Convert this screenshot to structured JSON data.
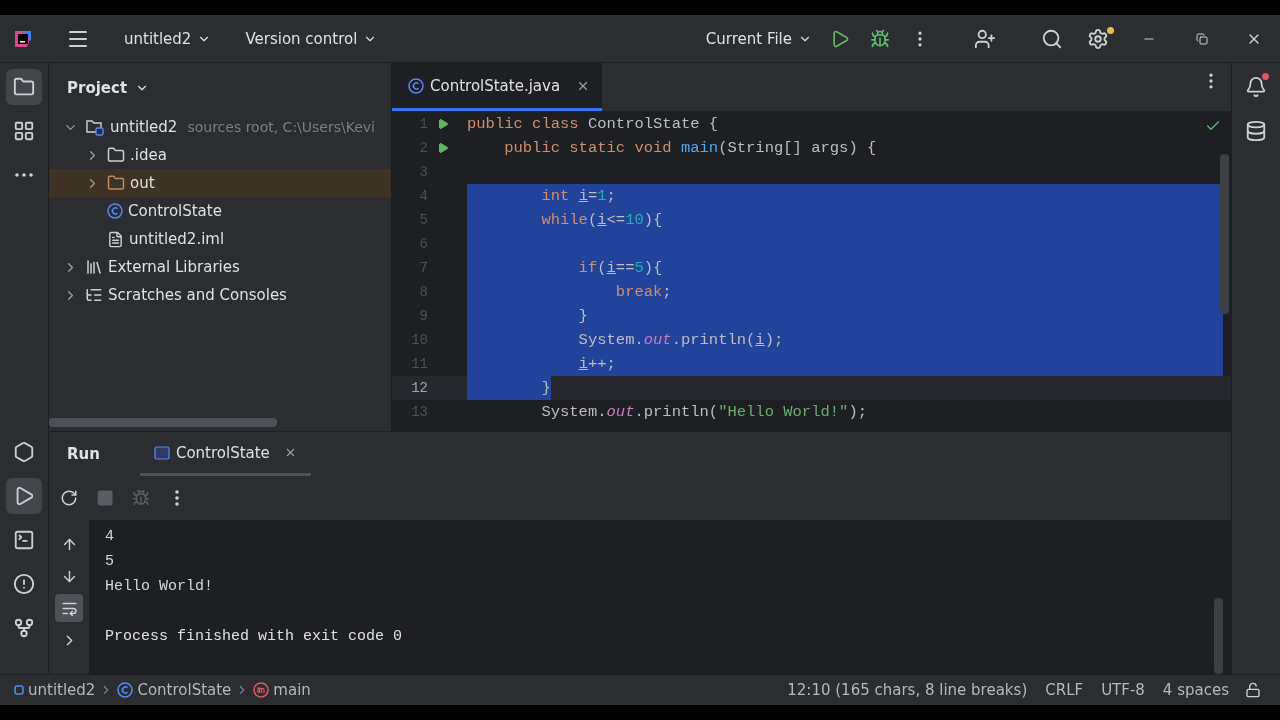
{
  "title_bar": {
    "project": "untitled2",
    "vcs": "Version control",
    "run_config": "Current File",
    "settings_badge": true
  },
  "left_stripe": {
    "top": [
      {
        "kind": "project",
        "selected": true
      },
      {
        "kind": "structure",
        "selected": false
      },
      {
        "kind": "more",
        "selected": false
      }
    ],
    "bottom": [
      {
        "kind": "services",
        "selected": false
      },
      {
        "kind": "run",
        "selected": true
      },
      {
        "kind": "terminal",
        "selected": false
      },
      {
        "kind": "problems",
        "selected": false
      },
      {
        "kind": "git",
        "selected": false
      }
    ]
  },
  "project_panel": {
    "title": "Project",
    "tree": [
      {
        "label": "untitled2",
        "kind": "module",
        "hint": "sources root,  C:\\Users\\Kevi",
        "expanded": true,
        "children": [
          {
            "label": ".idea",
            "kind": "folder",
            "expanded": false
          },
          {
            "label": "out",
            "kind": "excluded_folder",
            "expanded": false
          },
          {
            "label": "ControlState",
            "kind": "class"
          },
          {
            "label": "untitled2.iml",
            "kind": "file"
          }
        ]
      },
      {
        "label": "External Libraries",
        "kind": "libraries",
        "expanded": false
      },
      {
        "label": "Scratches and Consoles",
        "kind": "scratches",
        "expanded": false
      }
    ]
  },
  "editor": {
    "tabs": [
      {
        "label": "ControlState.java",
        "selected": true
      }
    ],
    "inspection_ok": true,
    "lines": [
      {
        "number": "1",
        "run_marker": true,
        "selected": false,
        "current": false,
        "tokens": [
          {
            "text": "public class ",
            "kind": "keyword"
          },
          {
            "text": "ControlState {",
            "kind": "plain"
          }
        ]
      },
      {
        "number": "2",
        "run_marker": true,
        "selected": false,
        "current": false,
        "tokens": [
          {
            "text": "    public static void ",
            "kind": "keyword"
          },
          {
            "text": "main",
            "kind": "method"
          },
          {
            "text": "(String[] args) {",
            "kind": "plain"
          }
        ]
      },
      {
        "number": "3",
        "run_marker": false,
        "selected": false,
        "current": false
      },
      {
        "number": "4",
        "run_marker": false,
        "selected": true,
        "current": false,
        "tokens": [
          {
            "text": "        int ",
            "kind": "keyword"
          },
          {
            "text": "i",
            "kind": "var"
          },
          {
            "text": "=",
            "kind": "plain"
          },
          {
            "text": "1",
            "kind": "number"
          },
          {
            "text": ";",
            "kind": "plain"
          }
        ]
      },
      {
        "number": "5",
        "run_marker": false,
        "selected": true,
        "current": false,
        "tokens": [
          {
            "text": "        while",
            "kind": "keyword"
          },
          {
            "text": "(",
            "kind": "plain"
          },
          {
            "text": "i",
            "kind": "var"
          },
          {
            "text": "<=",
            "kind": "plain"
          },
          {
            "text": "10",
            "kind": "number"
          },
          {
            "text": "){",
            "kind": "plain"
          }
        ]
      },
      {
        "number": "6",
        "run_marker": false,
        "selected": true,
        "current": false
      },
      {
        "number": "7",
        "run_marker": false,
        "selected": true,
        "current": false,
        "tokens": [
          {
            "text": "            if",
            "kind": "keyword"
          },
          {
            "text": "(",
            "kind": "plain"
          },
          {
            "text": "i",
            "kind": "var"
          },
          {
            "text": "==",
            "kind": "plain"
          },
          {
            "text": "5",
            "kind": "number"
          },
          {
            "text": "){",
            "kind": "plain"
          }
        ]
      },
      {
        "number": "8",
        "run_marker": false,
        "selected": true,
        "current": false,
        "tokens": [
          {
            "text": "                break",
            "kind": "keyword"
          },
          {
            "text": ";",
            "kind": "plain"
          }
        ]
      },
      {
        "number": "9",
        "run_marker": false,
        "selected": true,
        "current": false,
        "tokens": [
          {
            "text": "            }",
            "kind": "plain"
          }
        ]
      },
      {
        "number": "10",
        "run_marker": false,
        "selected": true,
        "current": false,
        "tokens": [
          {
            "text": "            System.",
            "kind": "plain"
          },
          {
            "text": "out",
            "kind": "field"
          },
          {
            "text": ".println(",
            "kind": "plain"
          },
          {
            "text": "i",
            "kind": "var"
          },
          {
            "text": ");",
            "kind": "plain"
          }
        ]
      },
      {
        "number": "11",
        "run_marker": false,
        "selected": true,
        "current": false,
        "tokens": [
          {
            "text": "            i",
            "kind": "var"
          },
          {
            "text": "++;",
            "kind": "plain"
          }
        ]
      },
      {
        "number": "12",
        "run_marker": false,
        "selected": true,
        "current": true,
        "tokens": [
          {
            "text": "        }",
            "kind": "plain"
          }
        ]
      },
      {
        "number": "13",
        "run_marker": false,
        "selected": false,
        "current": false,
        "tokens": [
          {
            "text": "        System.",
            "kind": "plain"
          },
          {
            "text": "out",
            "kind": "field"
          },
          {
            "text": ".println(",
            "kind": "plain"
          },
          {
            "text": "\"Hello World!\"",
            "kind": "string"
          },
          {
            "text": ");",
            "kind": "plain"
          }
        ]
      }
    ]
  },
  "right_stripe": {
    "notification_badge": true
  },
  "run_panel": {
    "title": "Run",
    "tabs": [
      {
        "label": "ControlState",
        "selected": true
      }
    ],
    "toolbar": [
      {
        "kind": "rerun",
        "disabled": false
      },
      {
        "kind": "stop",
        "disabled": true
      },
      {
        "kind": "debug",
        "disabled": true
      },
      {
        "kind": "more",
        "disabled": false
      }
    ],
    "side": [
      {
        "kind": "up",
        "selected": false
      },
      {
        "kind": "down",
        "selected": false
      },
      {
        "kind": "wrap",
        "selected": true
      },
      {
        "kind": "expand",
        "selected": false
      }
    ],
    "output": [
      {
        "text": "4",
        "kind": "stdout"
      },
      {
        "text": "5",
        "kind": "stdout"
      },
      {
        "text": "Hello World!",
        "kind": "stdout"
      },
      {
        "text": "Process finished with exit code 0",
        "kind": "exit"
      }
    ]
  },
  "status_bar": {
    "breadcrumbs": [
      {
        "label": "untitled2",
        "kind": "module"
      },
      {
        "label": "ControlState",
        "kind": "class"
      },
      {
        "label": "main",
        "kind": "method"
      }
    ],
    "items": [
      "12:10 (165 chars, 8 line breaks)",
      "CRLF",
      "UTF-8",
      "4 spaces"
    ],
    "read_only": false
  }
}
